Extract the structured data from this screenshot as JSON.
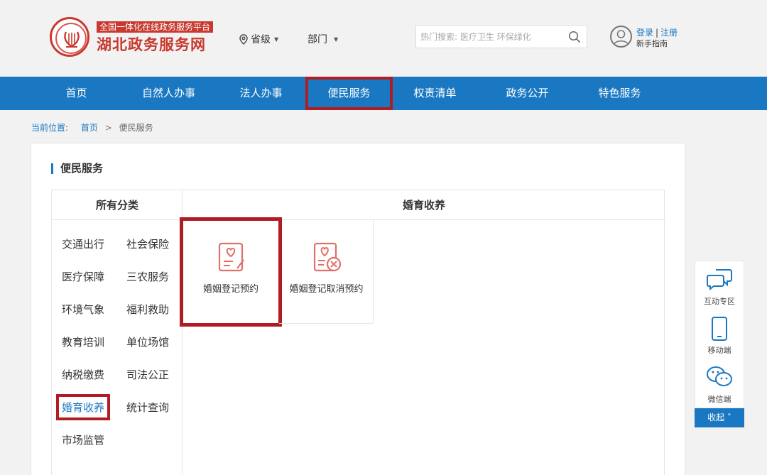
{
  "header": {
    "slogan": "全国一体化在线政务服务平台",
    "site_title": "湖北政务服务网",
    "region_label": "省级",
    "dept_label": "部门",
    "search_placeholder": "热门搜索: 医疗卫生 环保绿化",
    "login": "登录",
    "register": "注册",
    "guide": "新手指南"
  },
  "nav": {
    "items": [
      "首页",
      "自然人办事",
      "法人办事",
      "便民服务",
      "权责清单",
      "政务公开",
      "特色服务"
    ],
    "active": "便民服务"
  },
  "breadcrumb": {
    "label": "当前位置:",
    "home": "首页",
    "current": "便民服务"
  },
  "main": {
    "title": "便民服务",
    "left_header": "所有分类",
    "right_header": "婚育收养",
    "categories": [
      "交通出行",
      "社会保险",
      "医疗保障",
      "三农服务",
      "环境气象",
      "福利救助",
      "教育培训",
      "单位场馆",
      "纳税缴费",
      "司法公正",
      "婚育收养",
      "统计查询",
      "市场监管"
    ],
    "active_category": "婚育收养",
    "services": [
      "婚姻登记预约",
      "婚姻登记取消预约"
    ]
  },
  "side_tools": {
    "items": [
      "互动专区",
      "移动端",
      "微信端"
    ],
    "collapse": "收起"
  },
  "colors": {
    "primary": "#1a78c2",
    "brand_red": "#c8392f",
    "highlight_red": "#b01c22",
    "icon_pink": "#e0706a"
  }
}
